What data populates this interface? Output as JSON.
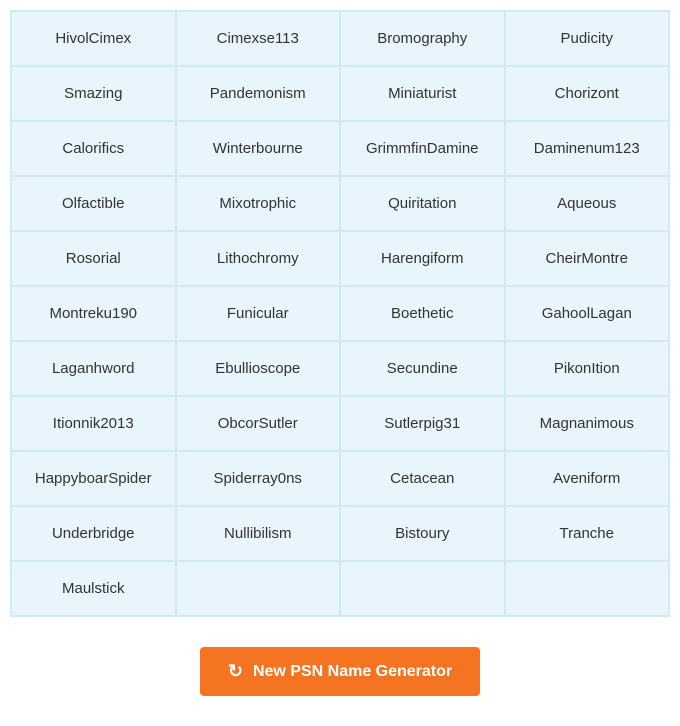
{
  "grid": {
    "cells": [
      "HivolCimex",
      "Cimexse113",
      "Bromography",
      "Pudicity",
      "Smazing",
      "Pandemonism",
      "Miniaturist",
      "Chorizont",
      "Calorifics",
      "Winterbourne",
      "GrimmfinDamine",
      "Daminenum123",
      "Olfactible",
      "Mixotrophic",
      "Quiritation",
      "Aqueous",
      "Rosorial",
      "Lithochromy",
      "Harengiform",
      "CheirMontre",
      "Montreku190",
      "Funicular",
      "Boethetic",
      "GahoolLagan",
      "Laganhword",
      "Ebullioscope",
      "Secundine",
      "PikonItion",
      "Itionnik2013",
      "ObcorSutler",
      "Sutlerpig31",
      "Magnanimous",
      "HappyboarSpider",
      "Spiderray0ns",
      "Cetacean",
      "Aveniform",
      "Underbridge",
      "Nullibilism",
      "Bistoury",
      "Tranche",
      "Maulstick",
      "",
      "",
      ""
    ]
  },
  "button": {
    "label": "New PSN Name Generator",
    "icon": "↻"
  }
}
